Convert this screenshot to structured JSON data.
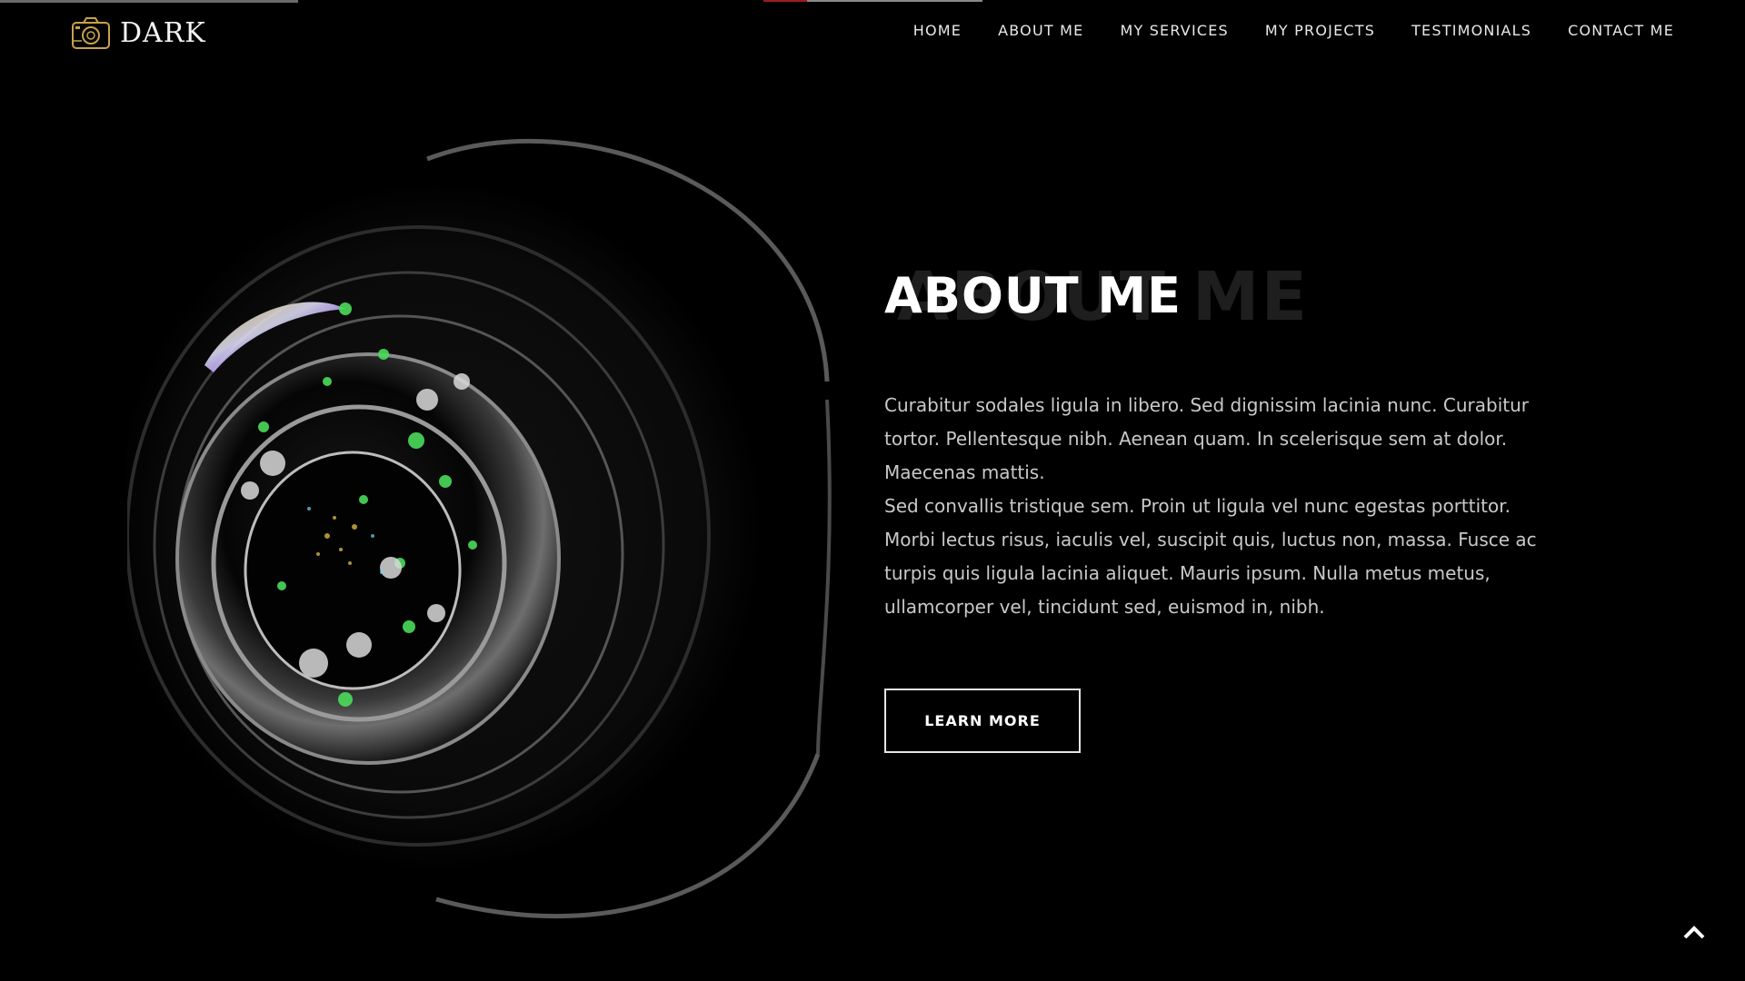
{
  "brand": {
    "name": "DARK",
    "icon": "camera-icon",
    "icon_color": "#c8a24a"
  },
  "nav": {
    "items": [
      {
        "label": "HOME"
      },
      {
        "label": "ABOUT ME"
      },
      {
        "label": "MY SERVICES"
      },
      {
        "label": "MY PROJECTS"
      },
      {
        "label": "TESTIMONIALS"
      },
      {
        "label": "CONTACT ME"
      }
    ]
  },
  "about": {
    "title": "ABOUT ME",
    "title_shadow": "ABOUT ME",
    "paragraphs": [
      "Curabitur sodales ligula in libero. Sed dignissim lacinia nunc. Curabitur tortor. Pellentesque nibh. Aenean quam. In scelerisque sem at dolor. Maecenas mattis.",
      "Sed convallis tristique sem. Proin ut ligula vel nunc egestas porttitor. Morbi lectus risus, iaculis vel, suscipit quis, luctus non, massa. Fusce ac turpis quis ligula lacinia aliquet. Mauris ipsum. Nulla metus metus, ullamcorper vel, tincidunt sed, euismod in, nibh."
    ],
    "button_label": "LEARN MORE"
  },
  "scroll_top": {
    "icon": "chevron-up-icon"
  },
  "colors": {
    "background": "#000000",
    "text": "#ffffff",
    "muted_text": "#c9c9c9",
    "shadow_title": "#1e1e1e",
    "accent_red": "#9b1b1b"
  }
}
